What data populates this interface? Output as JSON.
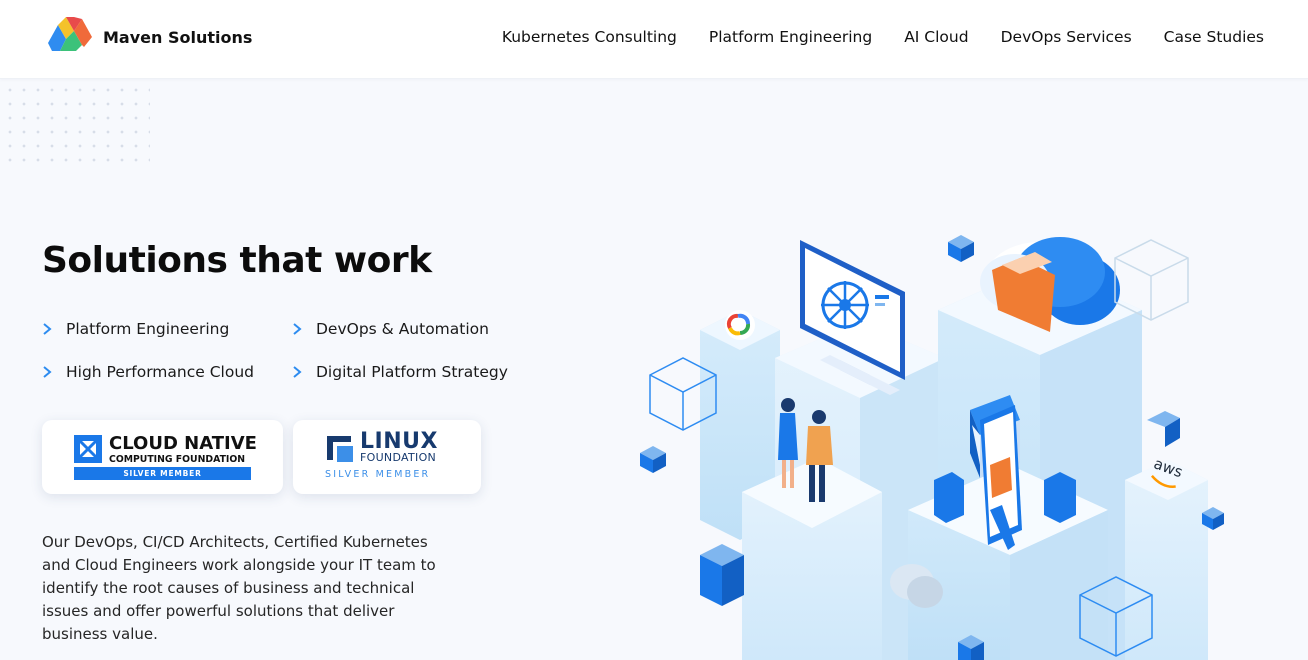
{
  "header": {
    "brand": "Maven Solutions",
    "logo_icon": "maven-triangles-logo",
    "nav": [
      {
        "label": "Kubernetes Consulting"
      },
      {
        "label": "Platform Engineering"
      },
      {
        "label": "AI Cloud"
      },
      {
        "label": "DevOps Services"
      },
      {
        "label": "Case Studies"
      }
    ]
  },
  "hero": {
    "title": "Solutions that work",
    "features": [
      {
        "label": "Platform Engineering",
        "icon": "chevron-right-icon"
      },
      {
        "label": "DevOps & Automation",
        "icon": "chevron-right-icon"
      },
      {
        "label": "High Performance Cloud",
        "icon": "chevron-right-icon"
      },
      {
        "label": "Digital Platform Strategy",
        "icon": "chevron-right-icon"
      }
    ],
    "badges": {
      "cncf": {
        "line1": "CLOUD NATIVE",
        "line2": "COMPUTING FOUNDATION",
        "tier": "SILVER MEMBER"
      },
      "linux": {
        "line1": "LINUX",
        "line2": "FOUNDATION",
        "tier": "SILVER MEMBER"
      }
    },
    "description": "Our DevOps, CI/CD Architects, Certified Kubernetes and Cloud Engineers work alongside your IT team to identify the root causes of business and technical issues and offer powerful solutions that deliver business value."
  },
  "illustration": {
    "aws_text": "aws"
  },
  "colors": {
    "accent": "#1a78e8",
    "text": "#111111",
    "page_bg": "#f7f9fd",
    "chevron": "#2d8cf0",
    "orange": "#f07c33"
  }
}
